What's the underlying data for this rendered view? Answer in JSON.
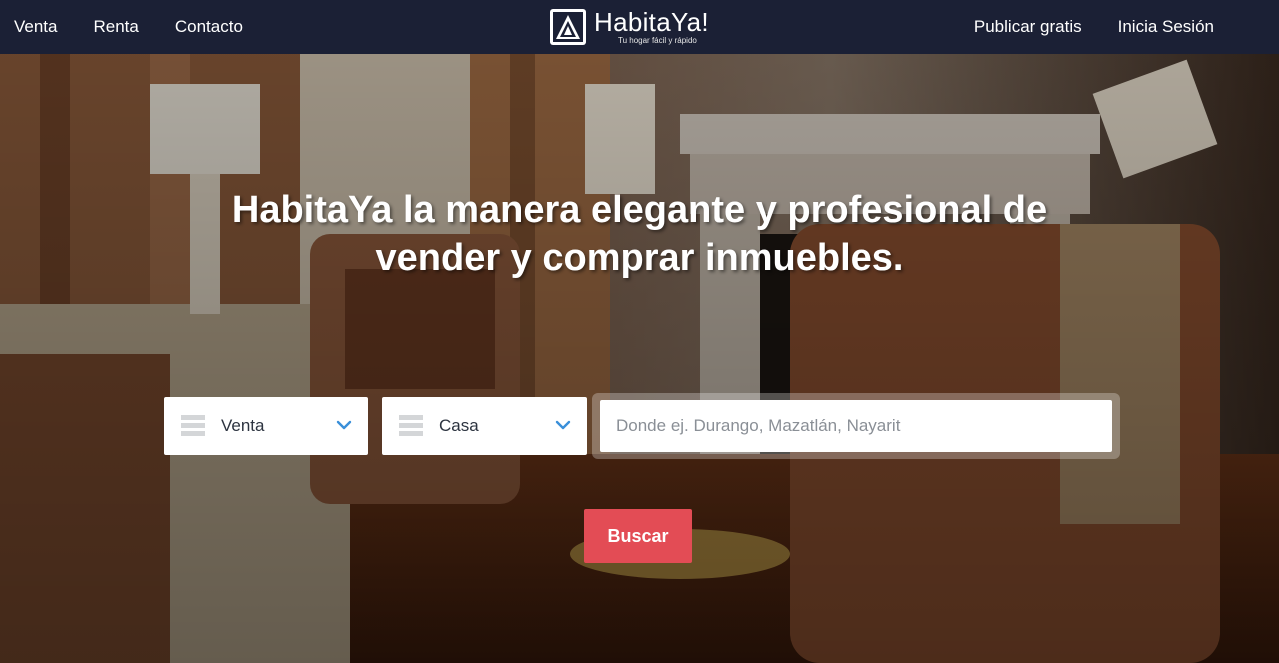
{
  "nav": {
    "left": [
      {
        "label": "Venta"
      },
      {
        "label": "Renta"
      },
      {
        "label": "Contacto"
      }
    ],
    "right": [
      {
        "label": "Publicar gratis"
      },
      {
        "label": "Inicia Sesión"
      }
    ]
  },
  "brand": {
    "name": "HabitaYa!",
    "tagline": "Tu hogar fácil y rápido",
    "logo_icon": "triangle-a-logo"
  },
  "hero": {
    "headline_line1": "HabitaYa la manera elegante y profesional de",
    "headline_line2": "vender y comprar inmuebles."
  },
  "search": {
    "operation": {
      "selected": "Venta",
      "icon": "list-icon"
    },
    "property_type": {
      "selected": "Casa",
      "icon": "list-icon"
    },
    "location": {
      "value": "",
      "placeholder": "Donde ej. Durango, Mazatlán, Nayarit"
    },
    "button_label": "Buscar"
  },
  "colors": {
    "navbar": "#1b2035",
    "accent_button": "#e34c55",
    "chevron": "#3a8fd9",
    "text_light": "#ffffff"
  }
}
